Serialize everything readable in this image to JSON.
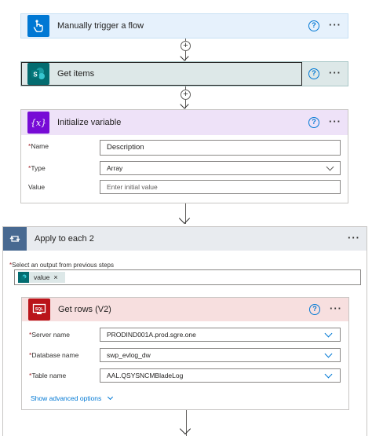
{
  "trigger": {
    "title": "Manually trigger a flow",
    "help": "?",
    "more": "···"
  },
  "get_items": {
    "title": "Get items",
    "icon_text": "S",
    "help": "?",
    "more": "···"
  },
  "init_var": {
    "title": "Initialize variable",
    "icon_text": "{x}",
    "help": "?",
    "more": "···",
    "fields": {
      "name_label": "Name",
      "name_value": "Description",
      "type_label": "Type",
      "type_value": "Array",
      "value_label": "Value",
      "value_placeholder": "Enter initial value"
    },
    "required_mark": "*"
  },
  "apply_each": {
    "title": "Apply to each 2",
    "more": "···",
    "select_label": "Select an output from previous steps",
    "token_label": "value",
    "token_close": "×"
  },
  "get_rows": {
    "title": "Get rows (V2)",
    "icon_text": "SQL",
    "help": "?",
    "more": "···",
    "server_label": "Server name",
    "server_value": "PRODIND001A.prod.sgre.one",
    "db_label": "Database name",
    "db_value": "swp_evlog_dw",
    "table_label": "Table name",
    "table_value": "AAL.QSYSNCMBladeLog",
    "advanced": "Show advanced options"
  },
  "colors": {
    "trigger_bg": "#e6f1fc",
    "trigger_icon": "#0078d4",
    "sp_bg": "#dde8e8",
    "sp_icon": "#036c70",
    "var_bg": "#eee2f8",
    "var_icon": "#770bd6",
    "loop_bg": "#e8ebef",
    "loop_icon": "#486991",
    "sql_bg": "#f7dfdf",
    "sql_icon": "#ba141a"
  }
}
